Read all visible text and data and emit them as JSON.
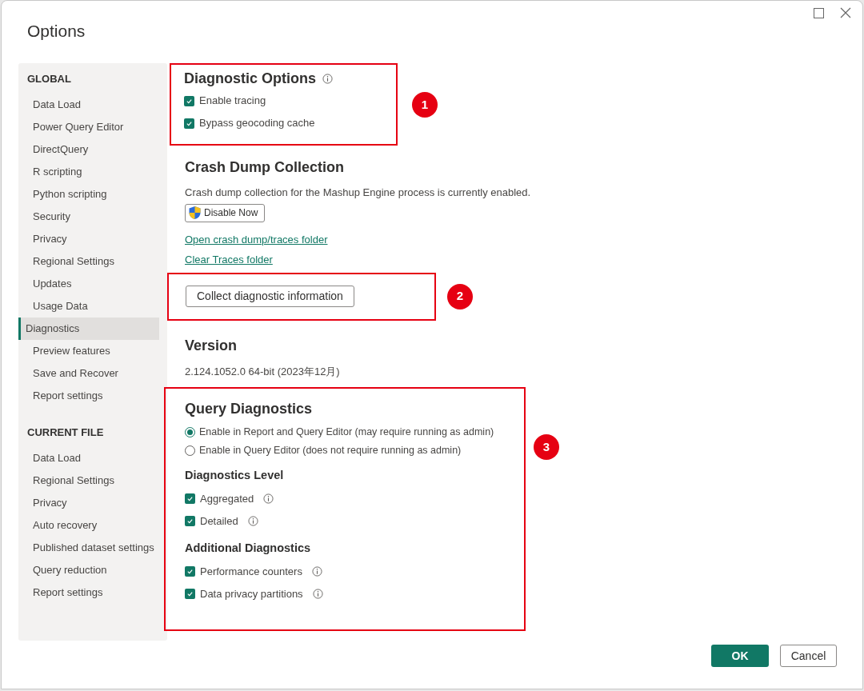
{
  "window": {
    "title": "Options"
  },
  "sidebar": {
    "groups": [
      {
        "heading": "GLOBAL",
        "items": [
          {
            "label": "Data Load",
            "selected": false
          },
          {
            "label": "Power Query Editor",
            "selected": false
          },
          {
            "label": "DirectQuery",
            "selected": false
          },
          {
            "label": "R scripting",
            "selected": false
          },
          {
            "label": "Python scripting",
            "selected": false
          },
          {
            "label": "Security",
            "selected": false
          },
          {
            "label": "Privacy",
            "selected": false
          },
          {
            "label": "Regional Settings",
            "selected": false
          },
          {
            "label": "Updates",
            "selected": false
          },
          {
            "label": "Usage Data",
            "selected": false
          },
          {
            "label": "Diagnostics",
            "selected": true
          },
          {
            "label": "Preview features",
            "selected": false
          },
          {
            "label": "Save and Recover",
            "selected": false
          },
          {
            "label": "Report settings",
            "selected": false
          }
        ]
      },
      {
        "heading": "CURRENT FILE",
        "items": [
          {
            "label": "Data Load",
            "selected": false
          },
          {
            "label": "Regional Settings",
            "selected": false
          },
          {
            "label": "Privacy",
            "selected": false
          },
          {
            "label": "Auto recovery",
            "selected": false
          },
          {
            "label": "Published dataset settings",
            "selected": false
          },
          {
            "label": "Query reduction",
            "selected": false
          },
          {
            "label": "Report settings",
            "selected": false
          }
        ]
      }
    ]
  },
  "diagnostic_options": {
    "title": "Diagnostic Options",
    "callout": "1",
    "options": [
      {
        "label": "Enable tracing",
        "checked": true
      },
      {
        "label": "Bypass geocoding cache",
        "checked": true
      }
    ]
  },
  "crash_dump": {
    "title": "Crash Dump Collection",
    "text": "Crash dump collection for the Mashup Engine process is currently enabled.",
    "button": "Disable Now",
    "links": [
      "Open crash dump/traces folder",
      "Clear Traces folder"
    ]
  },
  "collect": {
    "button": "Collect diagnostic information",
    "callout": "2"
  },
  "version": {
    "title": "Version",
    "text": "2.124.1052.0 64-bit (2023年12月)"
  },
  "query_diagnostics": {
    "title": "Query Diagnostics",
    "callout": "3",
    "modes": [
      {
        "label": "Enable in Report and Query Editor (may require running as admin)",
        "selected": true
      },
      {
        "label": "Enable in Query Editor (does not require running as admin)",
        "selected": false
      }
    ],
    "groups": [
      {
        "title": "Diagnostics Level",
        "options": [
          {
            "label": "Aggregated",
            "checked": true
          },
          {
            "label": "Detailed",
            "checked": true
          }
        ]
      },
      {
        "title": "Additional Diagnostics",
        "options": [
          {
            "label": "Performance counters",
            "checked": true
          },
          {
            "label": "Data privacy partitions",
            "checked": true
          }
        ]
      }
    ]
  },
  "buttons": {
    "ok": "OK",
    "cancel": "Cancel"
  }
}
